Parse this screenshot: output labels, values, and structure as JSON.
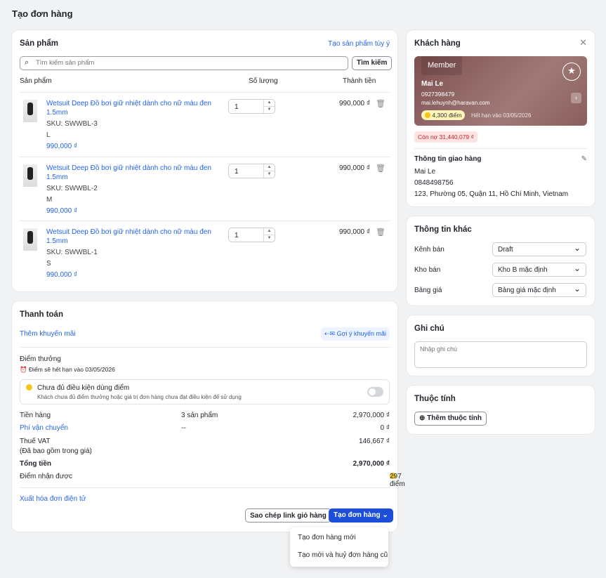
{
  "page_title": "Tạo đơn hàng",
  "products": {
    "title": "Sản phẩm",
    "custom_link": "Tạo sản phẩm tùy ý",
    "search_placeholder": "Tìm kiếm sản phẩm",
    "search_button": "Tìm kiếm",
    "columns": [
      "Sản phẩm",
      "Số lượng",
      "Thành tiền"
    ],
    "items": [
      {
        "name": "Wetsuit Deep Đồ bơi giữ nhiệt dành cho nữ màu đen",
        "name2": "1.5mm",
        "sku": "SKU: SWWBL-3",
        "variant": "L",
        "price": "990,000 ₫",
        "qty": "1",
        "total": "990,000 ₫"
      },
      {
        "name": "Wetsuit Deep Đồ bơi giữ nhiệt dành cho nữ màu đen",
        "name2": "1.5mm",
        "sku": "SKU: SWWBL-2",
        "variant": "M",
        "price": "990,000 ₫",
        "qty": "1",
        "total": "990,000 ₫"
      },
      {
        "name": "Wetsuit Deep Đồ bơi giữ nhiệt dành cho nữ màu đen",
        "name2": "1.5mm",
        "sku": "SKU: SWWBL-1",
        "variant": "S",
        "price": "990,000 ₫",
        "qty": "1",
        "total": "990,000 ₫"
      }
    ]
  },
  "payment": {
    "title": "Thanh toán",
    "add_promo": "Thêm khuyến mãi",
    "suggest_promo": "Gợi ý khuyến mãi",
    "points_title": "Điểm thưởng",
    "points_expiry": "Điểm sẽ hết hạn vào 03/05/2026",
    "points_notice_title": "Chưa đủ điều kiện dùng điểm",
    "points_notice_desc": "Khách chưa đủ điểm thưởng hoặc giá trị đơn hàng chưa đạt điều kiện để sử dụng",
    "subtotal_label": "Tiền hàng",
    "subtotal_count": "3 sản phẩm",
    "subtotal": "2,970,000 ₫",
    "shipping_label": "Phí vận chuyển",
    "shipping_mid": "--",
    "shipping": "0 ₫",
    "vat_label": "Thuế VAT",
    "vat_note": "(Đã bao gồm trong giá)",
    "vat": "146,667 ₫",
    "total_label": "Tổng tiền",
    "total": "2,970,000 ₫",
    "earn_label": "Điểm nhận được",
    "earn": "297 điểm",
    "invoice_link": "Xuất hóa đơn điện tử",
    "copy_link": "Sao chép link giỏ hàng",
    "create": "Tạo đơn hàng",
    "menu": [
      "Tạo đơn hàng mới",
      "Tạo mới và huỷ đơn hàng cũ"
    ]
  },
  "customer": {
    "title": "Khách hàng",
    "tier": "Member",
    "name": "Mai Le",
    "phone": "0927398479",
    "email": "mai.lehuynh@haravan.com",
    "points": "4,300 điểm",
    "expiry": "Hết hạn vào 03/05/2026",
    "debt": "Còn nợ 31,440,079 ₫",
    "shipping_title": "Thông tin giao hàng",
    "ship_name": "Mai Le",
    "ship_phone": "0848498756",
    "ship_address": "123, Phường 05, Quận 11, Hồ Chí Minh, Vietnam"
  },
  "other": {
    "title": "Thông tin khác",
    "channel_label": "Kênh bán",
    "channel": "Draft",
    "warehouse_label": "Kho bán",
    "warehouse": "Kho B mặc định",
    "pricebook_label": "Bảng giá",
    "pricebook": "Bảng giá mặc định"
  },
  "notes": {
    "title": "Ghi chú",
    "placeholder": "Nhập ghi chú"
  },
  "attributes": {
    "title": "Thuộc tính",
    "add": "Thêm thuộc tính"
  }
}
